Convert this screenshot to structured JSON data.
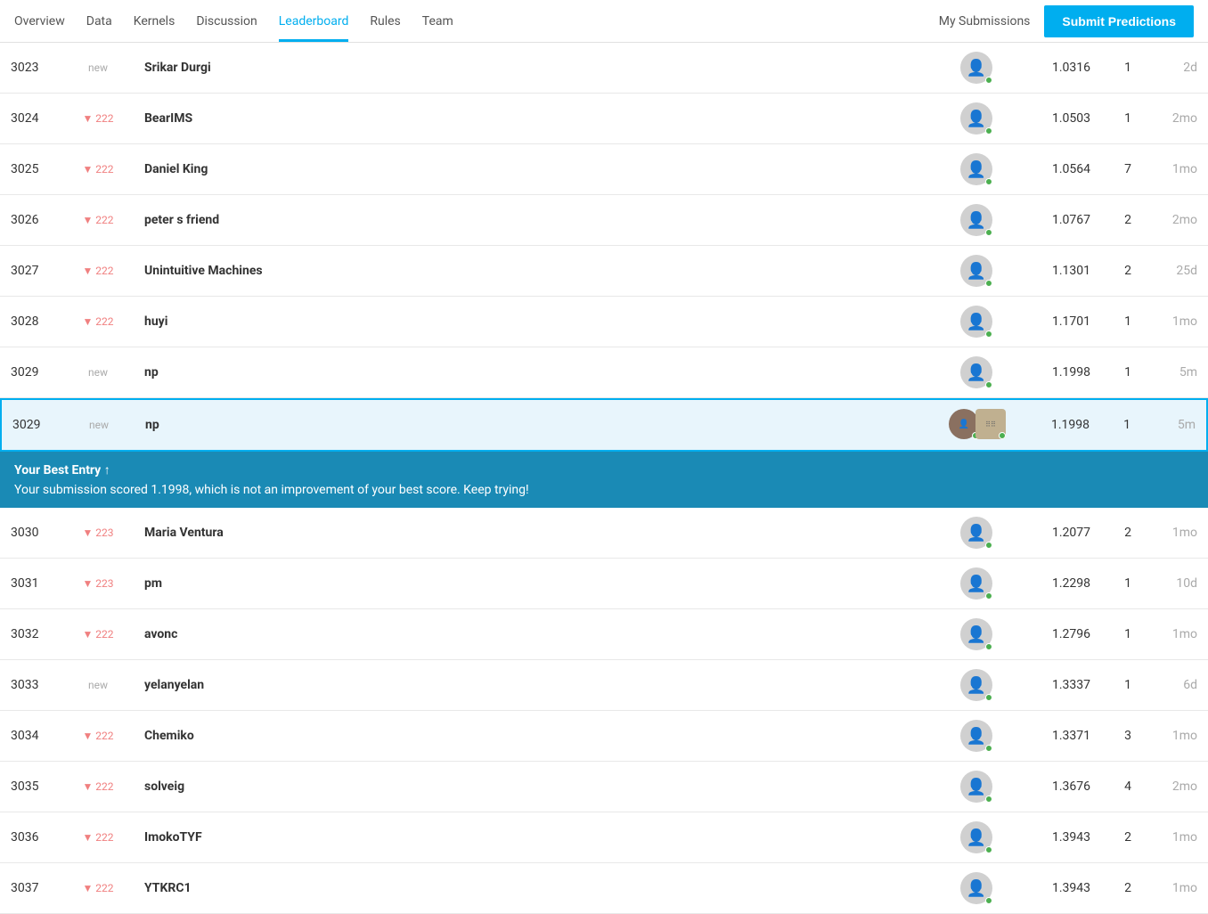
{
  "nav": {
    "items": [
      {
        "id": "overview",
        "label": "Overview",
        "active": false
      },
      {
        "id": "data",
        "label": "Data",
        "active": false
      },
      {
        "id": "kernels",
        "label": "Kernels",
        "active": false
      },
      {
        "id": "discussion",
        "label": "Discussion",
        "active": false
      },
      {
        "id": "leaderboard",
        "label": "Leaderboard",
        "active": true
      },
      {
        "id": "rules",
        "label": "Rules",
        "active": false
      },
      {
        "id": "team",
        "label": "Team",
        "active": false
      }
    ],
    "my_submissions": "My Submissions",
    "submit_button": "Submit Predictions"
  },
  "leaderboard": {
    "rows": [
      {
        "rank": "3023",
        "change": "new",
        "change_type": "new",
        "team": "Srikar Durgi",
        "score": "1.0316",
        "entries": "1",
        "last": "2d",
        "highlighted": false
      },
      {
        "rank": "3024",
        "change": "▼ 222",
        "change_type": "down",
        "team": "BearIMS",
        "score": "1.0503",
        "entries": "1",
        "last": "2mo",
        "highlighted": false
      },
      {
        "rank": "3025",
        "change": "▼ 222",
        "change_type": "down",
        "team": "Daniel King",
        "score": "1.0564",
        "entries": "7",
        "last": "1mo",
        "highlighted": false
      },
      {
        "rank": "3026",
        "change": "▼ 222",
        "change_type": "down",
        "team": "peter s friend",
        "score": "1.0767",
        "entries": "2",
        "last": "2mo",
        "highlighted": false
      },
      {
        "rank": "3027",
        "change": "▼ 222",
        "change_type": "down",
        "team": "Unintuitive Machines",
        "score": "1.1301",
        "entries": "2",
        "last": "25d",
        "highlighted": false
      },
      {
        "rank": "3028",
        "change": "▼ 222",
        "change_type": "down",
        "team": "huyi",
        "score": "1.1701",
        "entries": "1",
        "last": "1mo",
        "highlighted": false
      },
      {
        "rank": "3029",
        "change": "new",
        "change_type": "new",
        "team": "np",
        "score": "1.1998",
        "entries": "1",
        "last": "5m",
        "highlighted": true
      }
    ],
    "best_entry": {
      "title": "Your Best Entry ↑",
      "message": "Your submission scored 1.1998, which is not an improvement of your best score. Keep trying!"
    },
    "rows_below": [
      {
        "rank": "3030",
        "change": "▼ 223",
        "change_type": "down",
        "team": "Maria Ventura",
        "score": "1.2077",
        "entries": "2",
        "last": "1mo"
      },
      {
        "rank": "3031",
        "change": "▼ 223",
        "change_type": "down",
        "team": "pm",
        "score": "1.2298",
        "entries": "1",
        "last": "10d"
      },
      {
        "rank": "3032",
        "change": "▼ 222",
        "change_type": "down",
        "team": "avonc",
        "score": "1.2796",
        "entries": "1",
        "last": "1mo"
      },
      {
        "rank": "3033",
        "change": "new",
        "change_type": "new",
        "team": "yelanyelan",
        "score": "1.3337",
        "entries": "1",
        "last": "6d"
      },
      {
        "rank": "3034",
        "change": "▼ 222",
        "change_type": "down",
        "team": "Chemiko",
        "score": "1.3371",
        "entries": "3",
        "last": "1mo"
      },
      {
        "rank": "3035",
        "change": "▼ 222",
        "change_type": "down",
        "team": "solveig",
        "score": "1.3676",
        "entries": "4",
        "last": "2mo"
      },
      {
        "rank": "3036",
        "change": "▼ 222",
        "change_type": "down",
        "team": "ImokoTYF",
        "score": "1.3943",
        "entries": "2",
        "last": "1mo"
      },
      {
        "rank": "3037",
        "change": "▼ 222",
        "change_type": "down",
        "team": "YTKRC1",
        "score": "1.3943",
        "entries": "2",
        "last": "1mo"
      }
    ]
  }
}
